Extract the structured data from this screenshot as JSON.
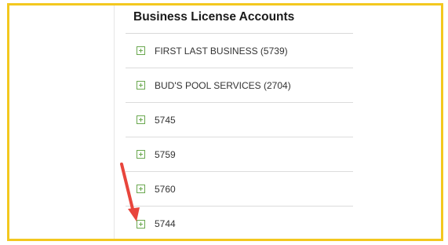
{
  "panel": {
    "title": "Business License Accounts"
  },
  "accounts": [
    {
      "label": "FIRST LAST BUSINESS (5739)",
      "icon": "expand-plus-icon"
    },
    {
      "label": "BUD'S POOL SERVICES (2704)",
      "icon": "expand-plus-icon"
    },
    {
      "label": "5745",
      "icon": "expand-plus-icon"
    },
    {
      "label": "5759",
      "icon": "expand-plus-icon"
    },
    {
      "label": "5760",
      "icon": "expand-plus-icon"
    },
    {
      "label": "5744",
      "icon": "expand-plus-icon"
    }
  ],
  "colors": {
    "frame_border": "#f3c81f",
    "expand_icon": "#6aa84f",
    "annotation_arrow": "#e8453c"
  }
}
